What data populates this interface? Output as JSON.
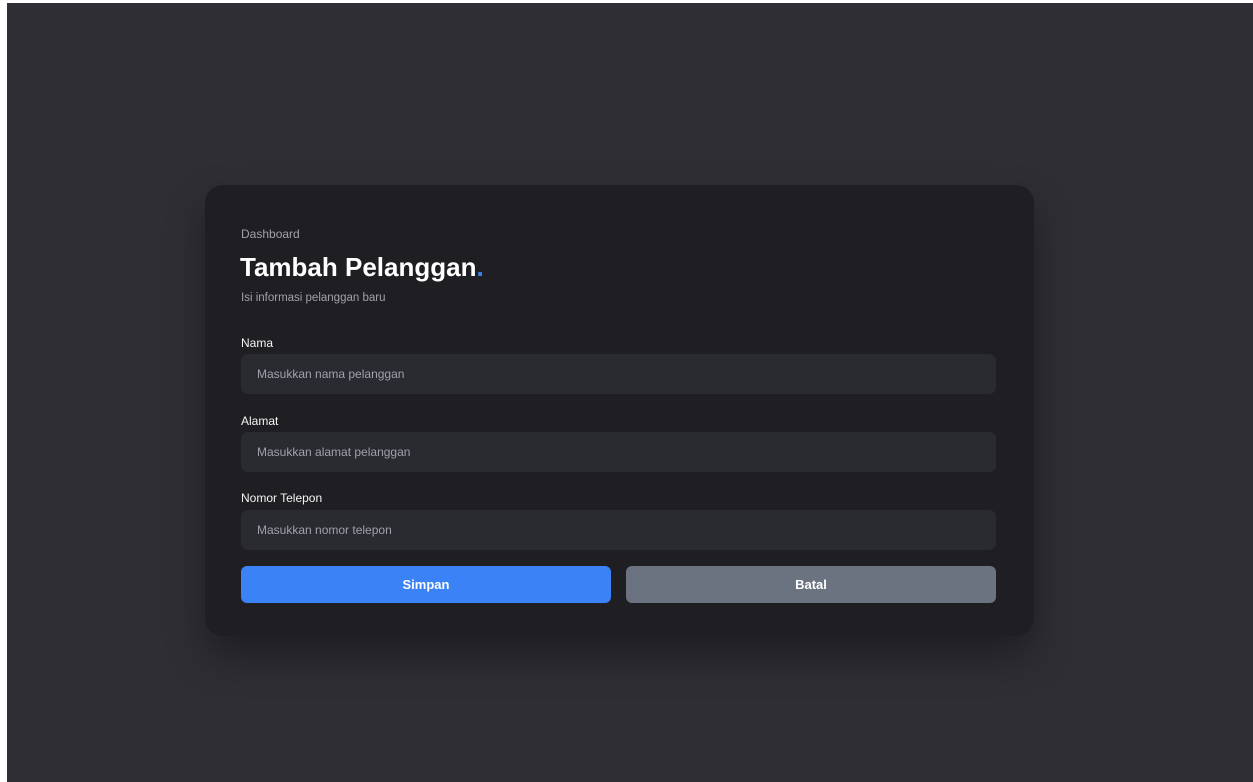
{
  "breadcrumb": "Dashboard",
  "page": {
    "title": "Tambah Pelanggan",
    "title_accent": ".",
    "subtitle": "Isi informasi pelanggan baru"
  },
  "form": {
    "fields": [
      {
        "label": "Nama",
        "placeholder": "Masukkan nama pelanggan",
        "value": ""
      },
      {
        "label": "Alamat",
        "placeholder": "Masukkan alamat pelanggan",
        "value": ""
      },
      {
        "label": "Nomor Telepon",
        "placeholder": "Masukkan nomor telepon",
        "value": ""
      }
    ],
    "submit_label": "Simpan",
    "cancel_label": "Batal"
  },
  "colors": {
    "background": "#2f2e34",
    "card": "#1f1f23",
    "input": "#2a2a31",
    "accent": "#3b82f6",
    "secondary_button": "#6b7280"
  }
}
